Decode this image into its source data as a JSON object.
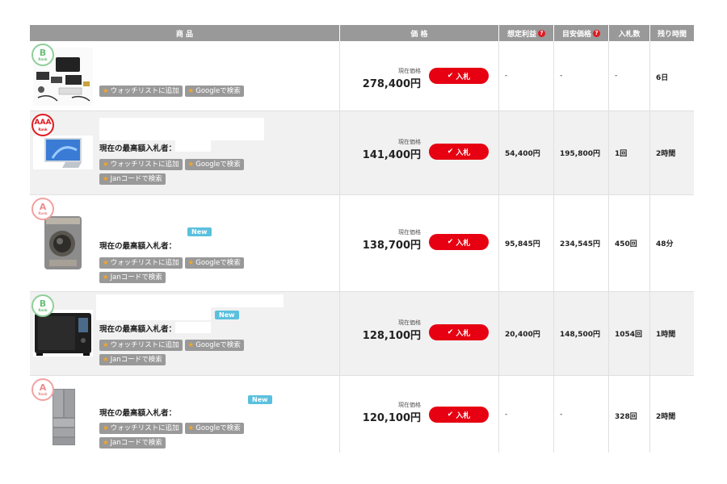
{
  "header": {
    "product": "商 品",
    "price": "価 格",
    "expected_profit": "想定利益",
    "estimated_price": "目安価格",
    "bid_count": "入札数",
    "time_left": "残り時間",
    "help_mark": "?"
  },
  "common": {
    "price_label": "現在価格",
    "bid_label": "入札",
    "highest_bidder_label": "現在の最高額入札者：",
    "watchlist_label": "ウォッチリストに追加",
    "google_label": "Googleで検索",
    "jan_label": "Janコードで検索",
    "new_label": "New",
    "grade_sub": "Rank"
  },
  "rows": [
    {
      "grade": "B",
      "price": "278,400円",
      "profit": "-",
      "estimate": "-",
      "bids": "-",
      "time": "6日"
    },
    {
      "grade": "AAA",
      "price": "141,400円",
      "profit": "54,400円",
      "estimate": "195,800円",
      "bids": "1回",
      "time": "2時間"
    },
    {
      "grade": "A",
      "price": "138,700円",
      "profit": "95,845円",
      "estimate": "234,545円",
      "bids": "450回",
      "time": "48分"
    },
    {
      "grade": "B",
      "price": "128,100円",
      "profit": "20,400円",
      "estimate": "148,500円",
      "bids": "1054回",
      "time": "1時間"
    },
    {
      "grade": "A",
      "price": "120,100円",
      "profit": "-",
      "estimate": "-",
      "bids": "328回",
      "time": "2時間"
    }
  ],
  "colors": {
    "accent_red": "#e60012",
    "header_gray": "#999999",
    "new_blue": "#5bc0de"
  }
}
